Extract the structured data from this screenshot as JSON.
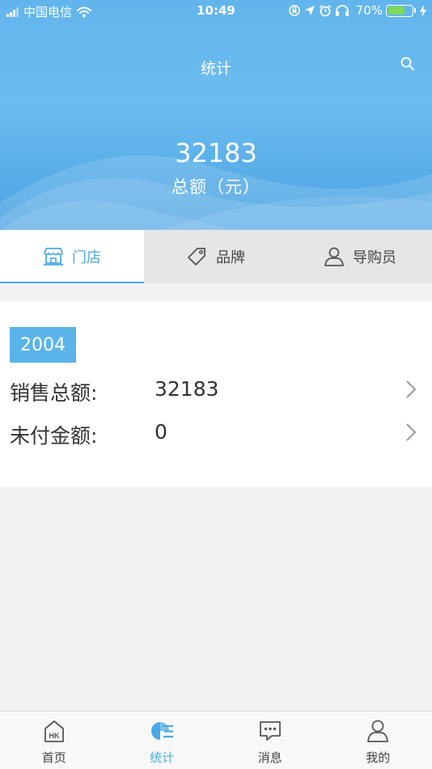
{
  "status_bar": {
    "carrier": "中国电信",
    "time": "10:49",
    "battery_percent": "70%",
    "battery_level": 0.7,
    "icons": [
      "signal-icon",
      "wifi-icon",
      "rotation-lock-icon",
      "location-icon",
      "alarm-icon",
      "headphones-icon",
      "charging-icon"
    ]
  },
  "header": {
    "title": "统计",
    "search_icon": "search-icon",
    "total_value": "32183",
    "total_label": "总额（元）",
    "background_color": "#62b5ec"
  },
  "tabs": [
    {
      "label": "门店",
      "icon": "store-icon",
      "active": true
    },
    {
      "label": "品牌",
      "icon": "tag-icon",
      "active": false
    },
    {
      "label": "导购员",
      "icon": "person-icon",
      "active": false
    }
  ],
  "card": {
    "badge": "2004",
    "rows": [
      {
        "label": "销售总额:",
        "value": "32183"
      },
      {
        "label": "未付金额:",
        "value": "0"
      }
    ]
  },
  "bottom_nav": [
    {
      "label": "首页",
      "icon": "home-icon",
      "active": false
    },
    {
      "label": "统计",
      "icon": "stats-icon",
      "active": true
    },
    {
      "label": "消息",
      "icon": "message-icon",
      "active": false
    },
    {
      "label": "我的",
      "icon": "profile-icon",
      "active": false
    }
  ],
  "colors": {
    "accent": "#48a9e6",
    "badge": "#5ab4ea",
    "tab_bar": "#e6e6e6",
    "page_background": "#f2f2f2"
  }
}
